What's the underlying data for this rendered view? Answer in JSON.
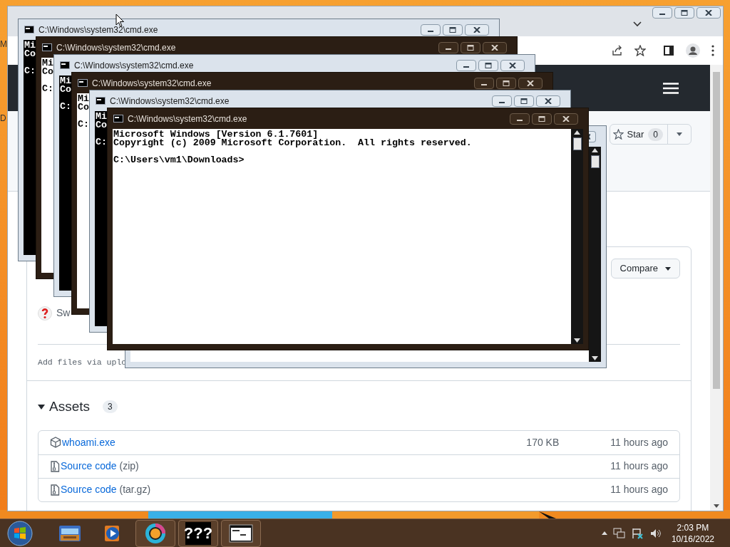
{
  "desktop": {
    "icon_labels": [
      "M",
      "D"
    ]
  },
  "browser": {
    "star": {
      "label": "Star",
      "count": "0"
    },
    "compare": "Compare",
    "release_text": "Sw",
    "commit_message": "Add files via uplo",
    "assets": {
      "title": "Assets",
      "count": "3",
      "expanded": true,
      "rows": [
        {
          "kind": "binary",
          "name": "whoami.exe",
          "size": "170 KB",
          "time": "11 hours ago"
        },
        {
          "kind": "archive",
          "name": "Source code",
          "suffix": "(zip)",
          "time": "11 hours ago"
        },
        {
          "kind": "archive",
          "name": "Source code",
          "suffix": "(tar.gz)",
          "time": "11 hours ago"
        }
      ]
    }
  },
  "cmd_windows": [
    {
      "kind": "light",
      "title": "C:\\Windows\\system32\\cmd.exe",
      "blocks": [
        [
          "Mi",
          "Co"
        ],
        [
          "C:"
        ]
      ]
    },
    {
      "kind": "dark",
      "title": "C:\\Windows\\system32\\cmd.exe",
      "blocks": [
        [
          "Mi",
          "Co"
        ],
        [
          "C:"
        ]
      ]
    },
    {
      "kind": "light",
      "title": "C:\\Windows\\system32\\cmd.exe",
      "blocks": [
        [
          "Mi",
          "Co"
        ],
        [
          "C:"
        ]
      ]
    },
    {
      "kind": "dark",
      "title": "C:\\Windows\\system32\\cmd.exe",
      "blocks": [
        [
          "Mi",
          "Co"
        ],
        [
          "C:"
        ]
      ]
    },
    {
      "kind": "light",
      "title": "C:\\Windows\\system32\\cmd.exe",
      "blocks": [
        [
          "Mi",
          "Co"
        ],
        [
          "C:"
        ]
      ]
    },
    {
      "kind": "pale"
    },
    {
      "kind": "dark",
      "title": "C:\\Windows\\system32\\cmd.exe",
      "blocks": [
        [
          "Microsoft Windows [Version 6.1.7601]",
          "Copyright (c) 2009 Microsoft Corporation.  All rights reserved."
        ],
        [
          "C:\\Users\\vm1\\Downloads>"
        ]
      ]
    }
  ],
  "taskbar": {
    "apps": [
      {
        "kind": "explorer",
        "active": false
      },
      {
        "kind": "media",
        "active": false
      },
      {
        "kind": "browser",
        "active": true
      },
      {
        "kind": "unknown",
        "label": "???",
        "active": true
      },
      {
        "kind": "cmd",
        "active": true
      }
    ],
    "clock": {
      "time": "2:03 PM",
      "date": "10/16/2022"
    }
  }
}
